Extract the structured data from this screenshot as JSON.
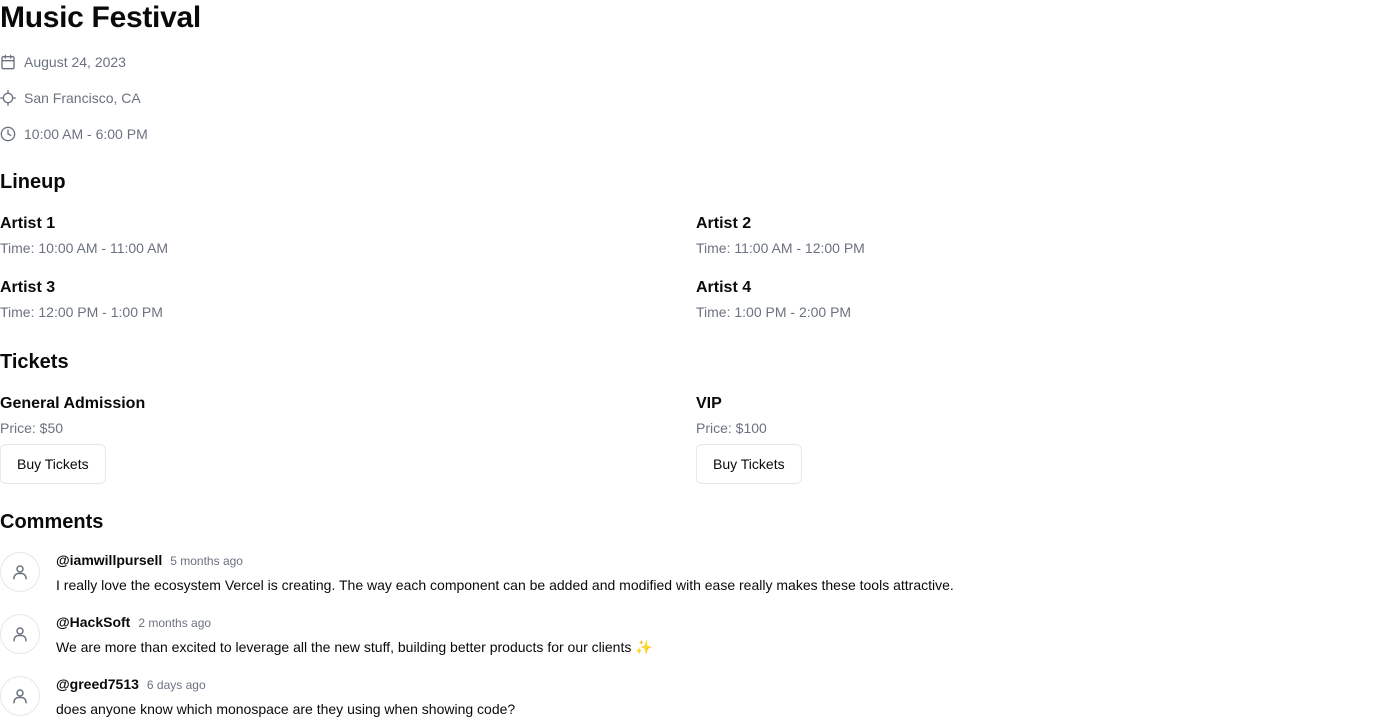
{
  "event": {
    "title": "Music Festival",
    "date": "August 24, 2023",
    "location": "San Francisco, CA",
    "hours": "10:00 AM - 6:00 PM",
    "icons": [
      "calendar-icon",
      "location-icon",
      "clock-icon"
    ]
  },
  "lineup": {
    "heading": "Lineup",
    "artists": [
      {
        "name": "Artist 1",
        "time": "Time: 10:00 AM - 11:00 AM"
      },
      {
        "name": "Artist 2",
        "time": "Time: 11:00 AM - 12:00 PM"
      },
      {
        "name": "Artist 3",
        "time": "Time: 12:00 PM - 1:00 PM"
      },
      {
        "name": "Artist 4",
        "time": "Time: 1:00 PM - 2:00 PM"
      }
    ]
  },
  "tickets": {
    "heading": "Tickets",
    "items": [
      {
        "name": "General Admission",
        "price": "Price: $50",
        "button": "Buy Tickets"
      },
      {
        "name": "VIP",
        "price": "Price: $100",
        "button": "Buy Tickets"
      }
    ]
  },
  "comments": {
    "heading": "Comments",
    "items": [
      {
        "user": "@iamwillpursell",
        "time": "5 months ago",
        "text": "I really love the ecosystem Vercel is creating. The way each component can be added and modified with ease really makes these tools attractive."
      },
      {
        "user": "@HackSoft",
        "time": "2 months ago",
        "text": "We are more than excited to leverage all the new stuff, building better products for our clients ✨"
      },
      {
        "user": "@greed7513",
        "time": "6 days ago",
        "text": "does anyone know which monospace are they using when showing code?"
      }
    ]
  },
  "colors": {
    "muted_text": "#6b7280",
    "border": "#e5e7eb",
    "text": "#0a0a0a"
  }
}
